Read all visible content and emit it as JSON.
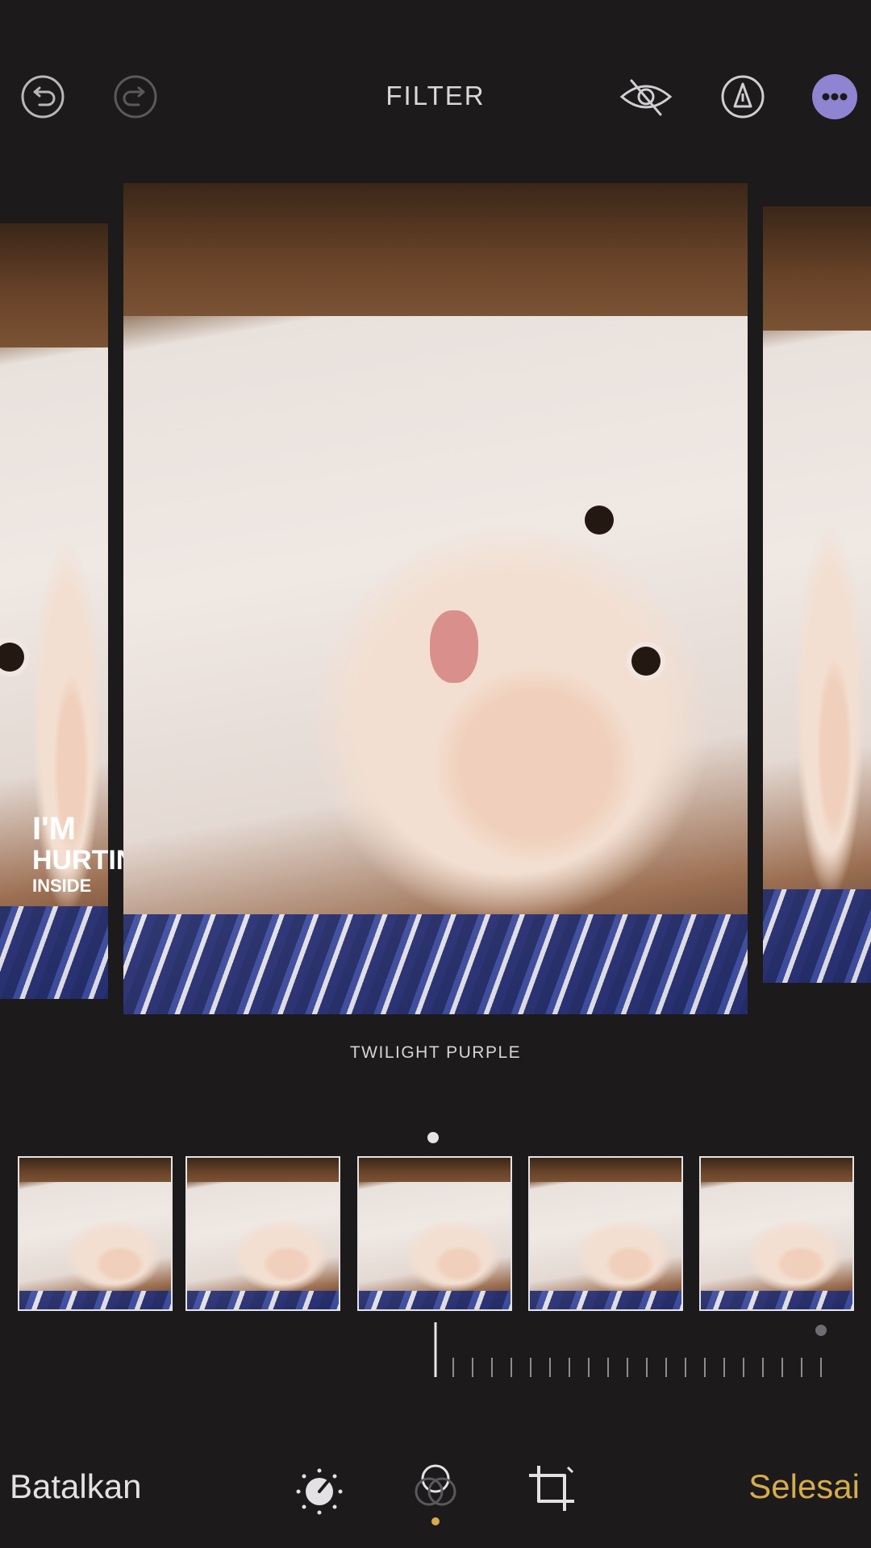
{
  "header": {
    "title": "FILTER",
    "icons": [
      "undo-icon",
      "redo-icon",
      "hide-icon",
      "markup-icon",
      "more-icon"
    ],
    "accent": "#8f84d1"
  },
  "overlay": {
    "line1": "I'M",
    "line2": "HURTING",
    "line3": "INSIDE"
  },
  "filter": {
    "name": "TWILIGHT PURPLE"
  },
  "thumbnails": 5,
  "footer": {
    "cancel_label": "Batalkan",
    "done_label": "Selesai",
    "done_color": "#d6ac4b",
    "tools": [
      "adjust-icon",
      "filter-icon",
      "crop-icon"
    ]
  }
}
